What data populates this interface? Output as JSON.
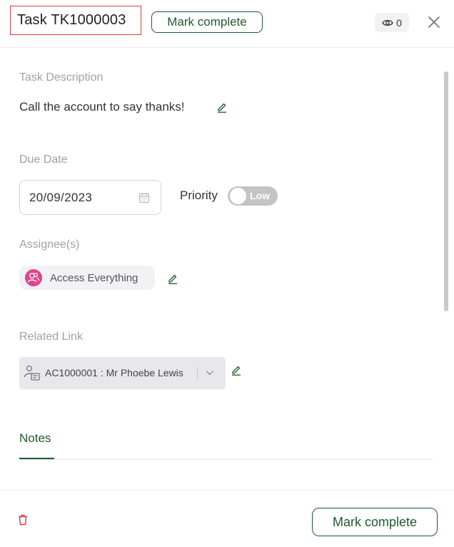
{
  "header": {
    "task_title": "Task TK1000003",
    "mark_complete_label": "Mark complete",
    "watch_count": "0"
  },
  "description": {
    "label": "Task Description",
    "text": "Call the account to say thanks!"
  },
  "due_date": {
    "label": "Due Date",
    "value": "20/09/2023"
  },
  "priority": {
    "label": "Priority",
    "value": "Low"
  },
  "assignees": {
    "label": "Assignee(s)",
    "items": [
      {
        "name": "Access Everything"
      }
    ]
  },
  "related_link": {
    "label": "Related Link",
    "value": "AC1000001 : Mr Phoebe Lewis"
  },
  "notes": {
    "tab_label": "Notes"
  },
  "footer": {
    "mark_complete_label": "Mark complete"
  },
  "colors": {
    "accent_green": "#1e5a2b",
    "title_border": "#e0393e",
    "avatar_pink": "#e24390",
    "trash_red": "#e0393e"
  }
}
